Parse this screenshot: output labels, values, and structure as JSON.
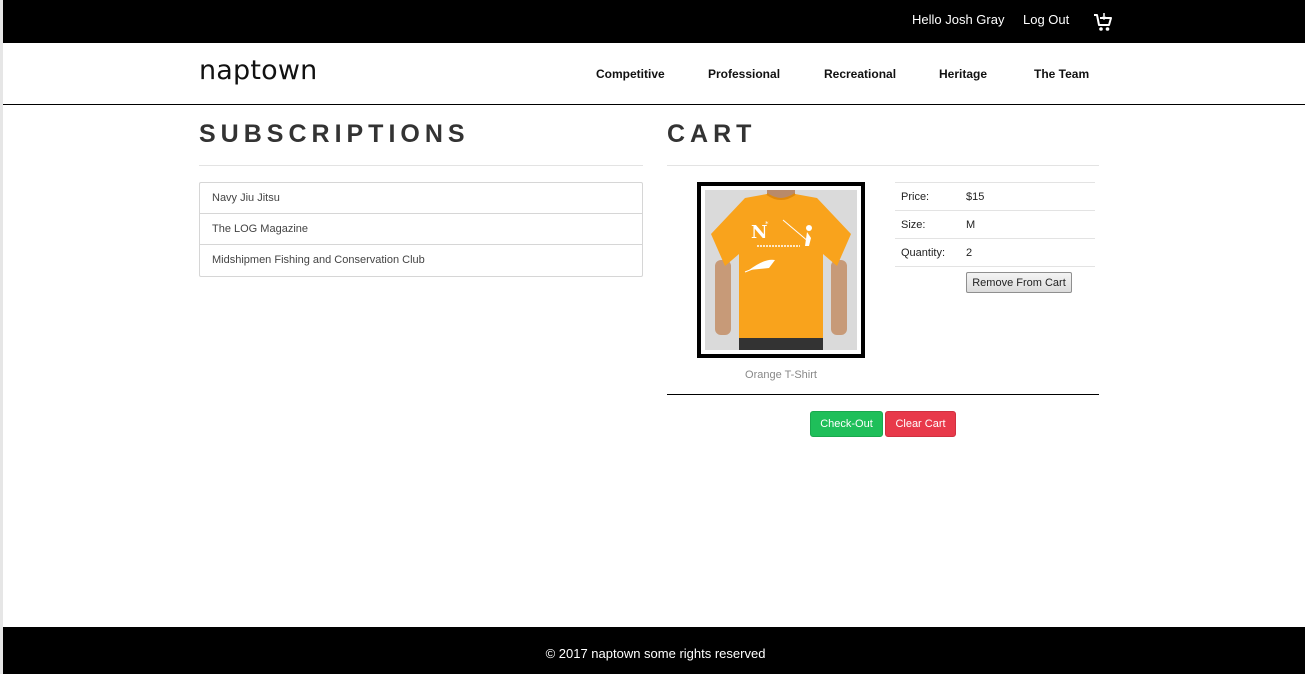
{
  "topbar": {
    "greeting": "Hello Josh Gray",
    "logout_label": "Log Out",
    "cart_icon": "shopping-cart-icon"
  },
  "nav": {
    "brand": "naptown",
    "links": [
      "Competitive",
      "Professional",
      "Recreational",
      "Heritage",
      "The Team"
    ]
  },
  "subscriptions": {
    "title": "SUBSCRIPTIONS",
    "items": [
      "Navy Jiu Jitsu",
      "The LOG Magazine",
      "Midshipmen Fishing and Conservation Club"
    ]
  },
  "cart": {
    "title": "CART",
    "item": {
      "name": "Orange T-Shirt",
      "price_label": "Price:",
      "price": "$15",
      "size_label": "Size:",
      "size": "M",
      "quantity_label": "Quantity:",
      "quantity": "2",
      "remove_label": "Remove From Cart",
      "image_icon": "orange-tshirt-image"
    },
    "checkout_label": "Check-Out",
    "clear_label": "Clear Cart"
  },
  "colors": {
    "checkout": "#1fbf5a",
    "clear": "#e8394a",
    "shirt": "#f9a31c"
  },
  "footer": {
    "copyright": "© 2017 naptown some rights reserved"
  }
}
